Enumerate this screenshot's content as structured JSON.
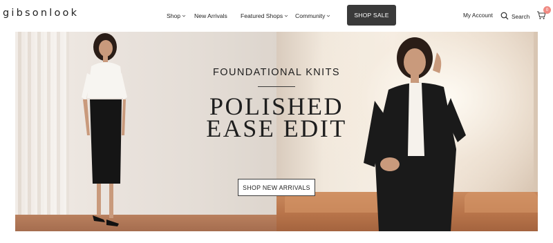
{
  "brand": {
    "logo_text": "gibsonlook"
  },
  "nav": {
    "items": [
      {
        "label": "Shop",
        "has_dropdown": true
      },
      {
        "label": "New Arrivals",
        "has_dropdown": false
      },
      {
        "label": "Featured Shops",
        "has_dropdown": true
      },
      {
        "label": "Community",
        "has_dropdown": true
      }
    ],
    "shop_sale_label": "SHOP SALE"
  },
  "header_right": {
    "account_label": "My Account",
    "search_label": "Search",
    "cart_count": "0"
  },
  "hero": {
    "eyebrow": "FOUNDATIONAL KNITS",
    "headline_line1": "POLISHED",
    "headline_line2": "EASE EDIT",
    "cta_label": "SHOP NEW ARRIVALS"
  },
  "colors": {
    "sale_button_bg": "#3a3a3a",
    "cart_badge": "#f08a83",
    "text_dark": "#1e1e1e"
  },
  "icons": [
    "chevron-down-icon",
    "search-icon",
    "cart-icon"
  ]
}
